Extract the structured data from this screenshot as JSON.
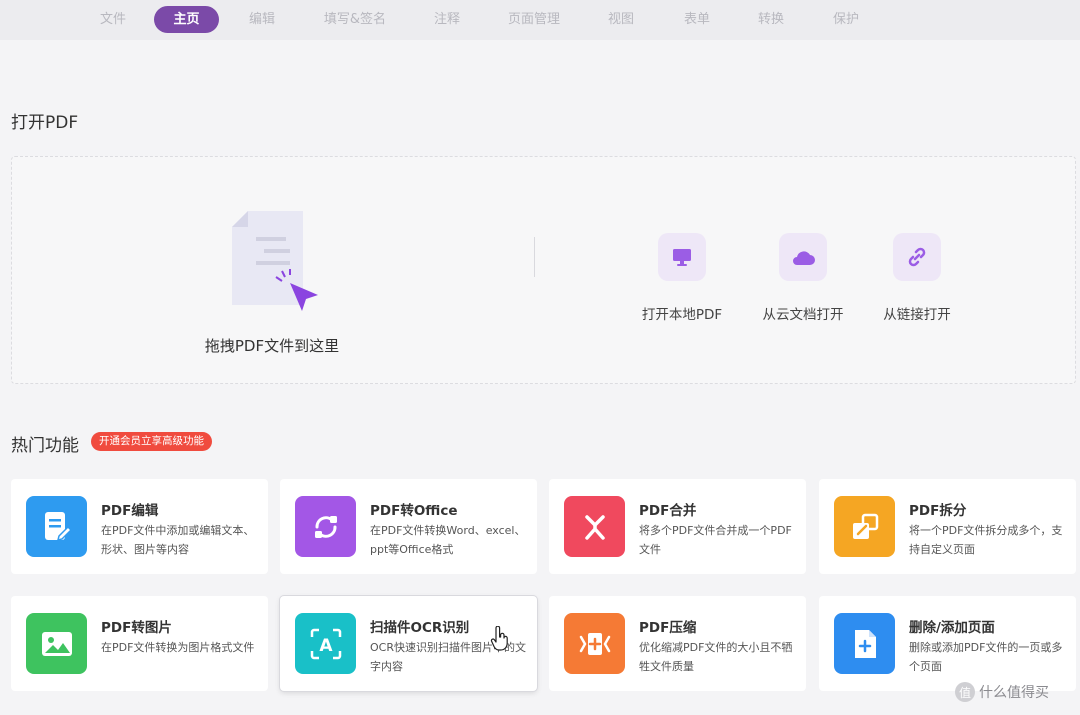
{
  "tabs": [
    {
      "label": "文件"
    },
    {
      "label": "主页",
      "active": true
    },
    {
      "label": "编辑"
    },
    {
      "label": "填写&签名"
    },
    {
      "label": "注释"
    },
    {
      "label": "页面管理"
    },
    {
      "label": "视图"
    },
    {
      "label": "表单"
    },
    {
      "label": "转换"
    },
    {
      "label": "保护"
    }
  ],
  "open_section": {
    "title": "打开PDF",
    "drop_label": "拖拽PDF文件到这里",
    "options": [
      {
        "label": "打开本地PDF",
        "icon": "monitor-icon"
      },
      {
        "label": "从云文档打开",
        "icon": "cloud-icon"
      },
      {
        "label": "从链接打开",
        "icon": "link-icon"
      }
    ]
  },
  "hot_section": {
    "title": "热门功能",
    "badge": "开通会员立享高级功能",
    "cards": [
      {
        "title": "PDF编辑",
        "desc": "在PDF文件中添加或编辑文本、形状、图片等内容",
        "icon": "edit-document-icon",
        "color": "#2e9bf0"
      },
      {
        "title": "PDF转Office",
        "desc": "在PDF文件转换Word、excel、ppt等Office格式",
        "icon": "convert-icon",
        "color": "#a357e6"
      },
      {
        "title": "PDF合并",
        "desc": "将多个PDF文件合并成一个PDF文件",
        "icon": "merge-icon",
        "color": "#f0495e"
      },
      {
        "title": "PDF拆分",
        "desc": "将一个PDF文件拆分成多个，支持自定义页面",
        "icon": "split-icon",
        "color": "#f5a623"
      },
      {
        "title": "PDF转图片",
        "desc": "在PDF文件转换为图片格式文件",
        "icon": "image-icon",
        "color": "#3ec35f"
      },
      {
        "title": "扫描件OCR识别",
        "desc": "OCR快速识别扫描件图片中的文字内容",
        "icon": "ocr-icon",
        "color": "#19c0c8"
      },
      {
        "title": "PDF压缩",
        "desc": "优化缩减PDF文件的大小且不牺牲文件质量",
        "icon": "compress-icon",
        "color": "#f57a35"
      },
      {
        "title": "删除/添加页面",
        "desc": "删除或添加PDF文件的一页或多个页面",
        "icon": "add-page-icon",
        "color": "#2e8df0"
      }
    ]
  },
  "watermark": "什么值得买"
}
